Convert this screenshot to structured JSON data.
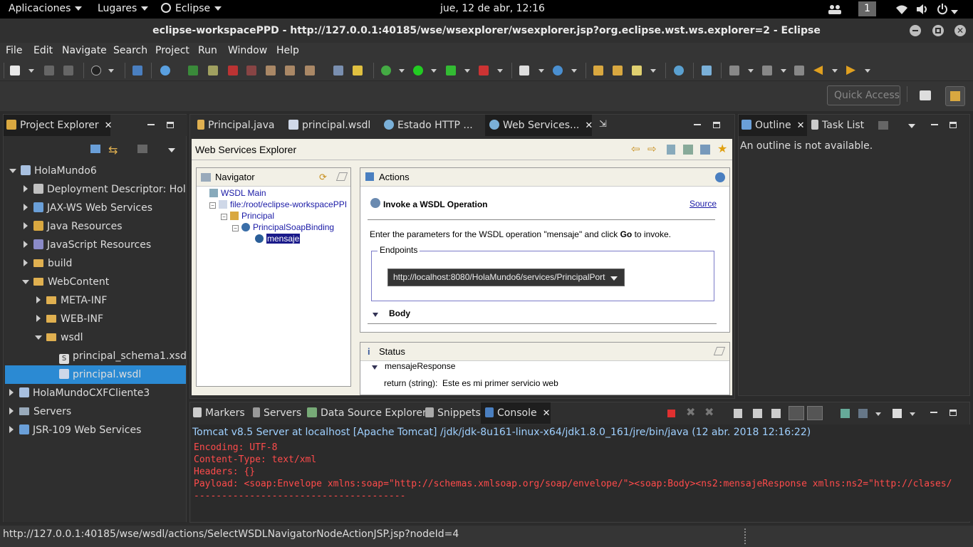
{
  "gnome": {
    "apps": "Aplicaciones",
    "places": "Lugares",
    "eclipse": "Eclipse",
    "clock": "jue, 12 de abr, 12:16",
    "workspace_num": "1"
  },
  "window": {
    "title": "eclipse-workspacePPD - http://127.0.0.1:40185/wse/wsexplorer/wsexplorer.jsp?org.eclipse.wst.ws.explorer=2 - Eclipse"
  },
  "menu": [
    "File",
    "Edit",
    "Navigate",
    "Search",
    "Project",
    "Run",
    "Window",
    "Help"
  ],
  "quick_access": {
    "placeholder": "Quick Access"
  },
  "project_explorer": {
    "tab": "Project Explorer",
    "items": [
      {
        "label": "HolaMundo6"
      },
      {
        "label": "Deployment Descriptor: HolaM"
      },
      {
        "label": "JAX-WS Web Services"
      },
      {
        "label": "Java Resources"
      },
      {
        "label": "JavaScript Resources"
      },
      {
        "label": "build"
      },
      {
        "label": "WebContent"
      },
      {
        "label": "META-INF"
      },
      {
        "label": "WEB-INF"
      },
      {
        "label": "wsdl"
      },
      {
        "label": "principal_schema1.xsd"
      },
      {
        "label": "principal.wsdl"
      },
      {
        "label": "HolaMundoCXFCliente3"
      },
      {
        "label": "Servers"
      },
      {
        "label": "JSR-109 Web Services"
      }
    ]
  },
  "editor_tabs": [
    "Principal.java",
    "principal.wsdl",
    "Estado HTTP ...",
    "Web Services..."
  ],
  "wse": {
    "title": "Web Services Explorer",
    "navigator": {
      "title": "Navigator",
      "nodes": [
        "WSDL Main",
        "file:/root/eclipse-workspacePPI",
        "Principal",
        "PrincipalSoapBinding",
        "mensaje"
      ]
    },
    "actions": {
      "title": "Actions",
      "heading": "Invoke a WSDL Operation",
      "source": "Source",
      "desc_before": "Enter the parameters for the WSDL operation \"mensaje\" and click ",
      "desc_go": "Go",
      "desc_after": " to invoke.",
      "endpoints_label": "Endpoints",
      "endpoint_value": "http://localhost:8080/HolaMundo6/services/PrincipalPort",
      "body_label": "Body"
    },
    "status": {
      "title": "Status",
      "response": "mensajeResponse",
      "return_label": "return (string):",
      "return_value": "Este es mi primer servicio web"
    }
  },
  "outline": {
    "tab": "Outline",
    "tab2": "Task List",
    "message": "An outline is not available."
  },
  "bottom_tabs": [
    "Markers",
    "Servers",
    "Data Source Explorer",
    "Snippets",
    "Console"
  ],
  "console": {
    "header": "Tomcat v8.5 Server at localhost [Apache Tomcat] /jdk/jdk-8u161-linux-x64/jdk1.8.0_161/jre/bin/java (12 abr. 2018 12:16:22)",
    "lines": [
      "Encoding: UTF-8",
      "Content-Type: text/xml",
      "Headers: {}",
      "Payload: <soap:Envelope xmlns:soap=\"http://schemas.xmlsoap.org/soap/envelope/\"><soap:Body><ns2:mensajeResponse xmlns:ns2=\"http://clases/",
      "--------------------------------------"
    ]
  },
  "status_bar": "http://127.0.0.1:40185/wse/wsdl/actions/SelectWSDLNavigatorNodeActionJSP.jsp?nodeId=4",
  "colors": {
    "accent": "#2b8ad3",
    "console_text": "#ff4b4b",
    "link": "#1a1aa6"
  }
}
